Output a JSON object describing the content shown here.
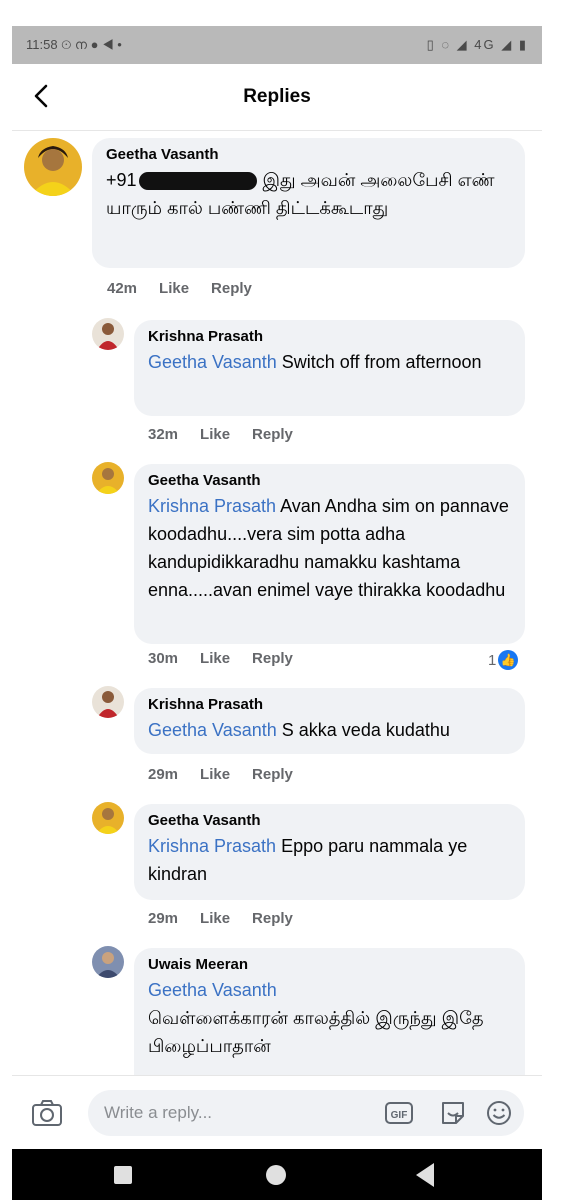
{
  "status_bar": {
    "time": "11:58",
    "left_icons": "⊙ ന ● ◀ •",
    "right_icons": "▯ ◌ ◢ 4G ◢ ▮"
  },
  "header": {
    "title": "Replies",
    "back_icon": "chevron-left-icon"
  },
  "comments": [
    {
      "author": "Geetha Vasanth",
      "text_prefix": "+91",
      "text": "இது அவன் அலைபேசி எண் யாரும் கால் பண்ணி திட்டக்கூடாது",
      "time": "42m",
      "like": "Like",
      "reply": "Reply"
    },
    {
      "author": "Krishna Prasath",
      "mention": "Geetha Vasanth",
      "text": "Switch off from afternoon",
      "time": "32m",
      "like": "Like",
      "reply": "Reply"
    },
    {
      "author": "Geetha Vasanth",
      "mention": "Krishna Prasath",
      "text": "Avan Andha sim on pannave koodadhu....vera sim potta adha kandupidikkaradhu namakku kashtama enna.....avan enimel vaye thirakka koodadhu",
      "time": "30m",
      "like": "Like",
      "reply": "Reply",
      "reactions": "1"
    },
    {
      "author": "Krishna Prasath",
      "mention": "Geetha Vasanth",
      "text": "S akka veda kudathu",
      "time": "29m",
      "like": "Like",
      "reply": "Reply"
    },
    {
      "author": "Geetha Vasanth",
      "mention": "Krishna Prasath",
      "text": "Eppo paru nammala ye kindran",
      "time": "29m",
      "like": "Like",
      "reply": "Reply"
    },
    {
      "author": "Uwais Meeran",
      "mention": "Geetha Vasanth",
      "text": "வெள்ளைக்காரன் காலத்தில் இருந்து இதே பிழைப்பாதான்"
    }
  ],
  "composer": {
    "placeholder": "Write a reply...",
    "gif_label": "GIF"
  },
  "colors": {
    "mention": "#3b72c4",
    "bubble": "#f0f2f5",
    "meta": "#65676b",
    "like_badge": "#1877f2"
  }
}
